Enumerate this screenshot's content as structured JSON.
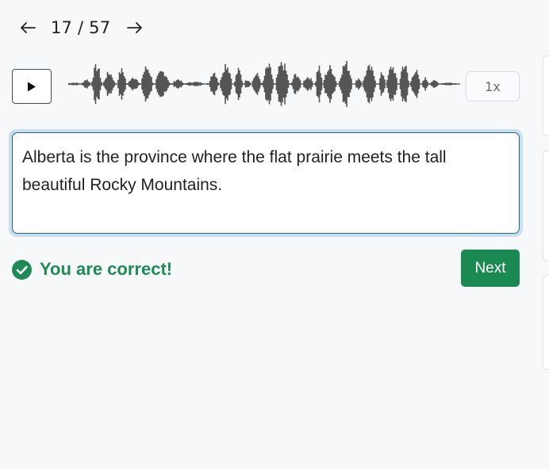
{
  "nav": {
    "prev_icon": "arrow-left-icon",
    "counter": "17 / 57",
    "next_icon": "arrow-right-icon"
  },
  "player": {
    "play_icon": "play-icon",
    "speed": "1x"
  },
  "answer": {
    "text": "Alberta is the province where the flat prairie meets the tall beautiful Rocky Mountains."
  },
  "feedback": {
    "icon": "check-circle-icon",
    "message": "You are correct!",
    "color": "#1f8a55"
  },
  "actions": {
    "next_label": "Next",
    "accent": "#1b8a52"
  }
}
